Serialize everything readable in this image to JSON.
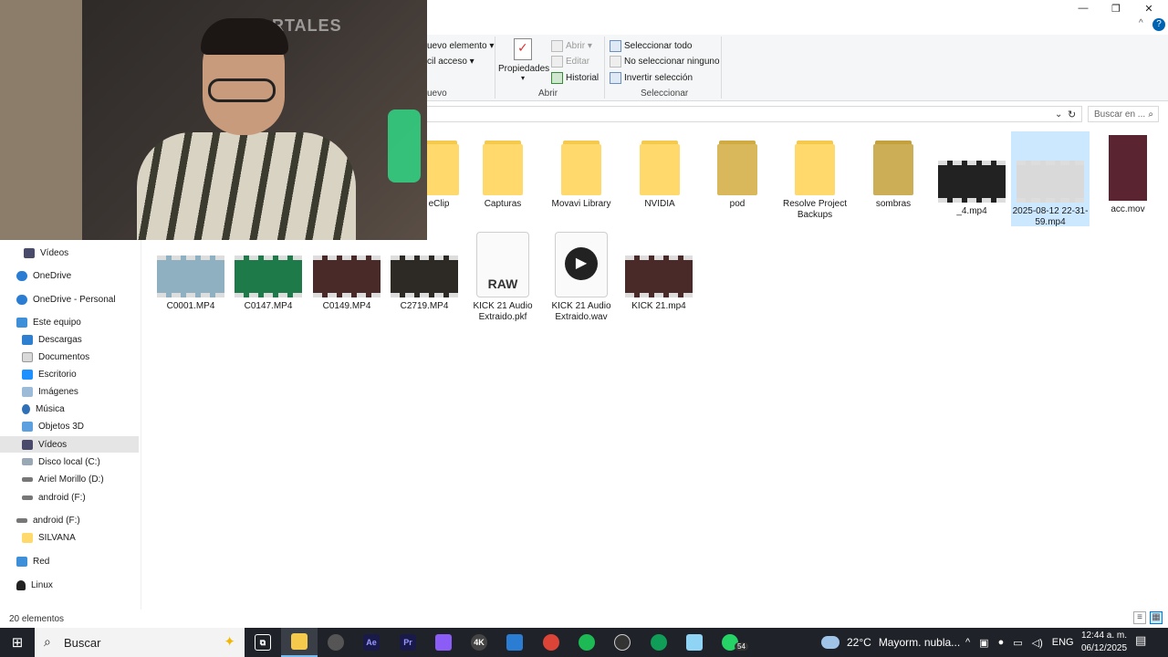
{
  "window": {
    "minimize": "—",
    "maximize": "❐",
    "close": "✕",
    "help": "?",
    "collapse": "^"
  },
  "ribbon": {
    "nuevo_elemento": "uevo elemento ▾",
    "facil_acceso": "cil acceso ▾",
    "nuevo_group": "uevo",
    "propiedades": "Propiedades",
    "abrir": "Abrir ▾",
    "editar": "Editar",
    "historial": "Historial",
    "abrir_group": "Abrir",
    "seleccionar_todo": "Seleccionar todo",
    "no_seleccionar": "No seleccionar ninguno",
    "invertir": "Invertir selección",
    "seleccionar_group": "Seleccionar"
  },
  "address": {
    "search_placeholder": "Buscar en ...",
    "search_icon": "search-icon"
  },
  "nav": {
    "items": [
      {
        "label": "Vídeos"
      },
      {
        "label": "OneDrive"
      },
      {
        "label": "OneDrive - Personal"
      },
      {
        "label": "Este equipo"
      },
      {
        "label": "Descargas"
      },
      {
        "label": "Documentos"
      },
      {
        "label": "Escritorio"
      },
      {
        "label": "Imágenes"
      },
      {
        "label": "Música"
      },
      {
        "label": "Objetos 3D"
      },
      {
        "label": "Vídeos"
      },
      {
        "label": "Disco local (C:)"
      },
      {
        "label": "Ariel Morillo (D:)"
      },
      {
        "label": "android (F:)"
      },
      {
        "label": "android (F:)"
      },
      {
        "label": "SILVANA"
      },
      {
        "label": "Red"
      },
      {
        "label": "Linux"
      }
    ]
  },
  "files": {
    "row1": [
      {
        "name": "eClip",
        "type": "folder"
      },
      {
        "name": "Capturas",
        "type": "folder"
      },
      {
        "name": "Movavi Library",
        "type": "folder"
      },
      {
        "name": "NVIDIA",
        "type": "folder"
      },
      {
        "name": "pod",
        "type": "folder"
      },
      {
        "name": "Resolve Project Backups",
        "type": "folder"
      },
      {
        "name": "sombras",
        "type": "folder"
      },
      {
        "name": "_4.mp4",
        "type": "video"
      },
      {
        "name": "2025-08-12 22-31-59.mp4",
        "type": "video"
      },
      {
        "name": "acc.mov",
        "type": "video"
      }
    ],
    "row2": [
      {
        "name": "C0001.MP4",
        "type": "video"
      },
      {
        "name": "C0147.MP4",
        "type": "video"
      },
      {
        "name": "C0149.MP4",
        "type": "video"
      },
      {
        "name": "C2719.MP4",
        "type": "video"
      },
      {
        "name": "KICK 21 Audio Extraido.pkf",
        "type": "raw",
        "badge": "RAW"
      },
      {
        "name": "KICK 21 Audio Extraido.wav",
        "type": "audio"
      },
      {
        "name": "KICK 21.mp4",
        "type": "video"
      }
    ]
  },
  "status": {
    "count": "20 elementos"
  },
  "taskbar": {
    "search_label": "Buscar",
    "weather_temp": "22°C",
    "weather_desc": "Mayorm. nubla...",
    "lang": "ENG",
    "time": "12:44 a. m.",
    "date": "06/12/2025",
    "badge": "54",
    "apps": [
      "task-view",
      "file-explorer",
      "resolve",
      "after-effects",
      "premiere",
      "app-purple",
      "4k-downloader",
      "remote-desktop",
      "chrome",
      "spotify",
      "obs",
      "chrome-2",
      "notepad",
      "whatsapp"
    ]
  },
  "webcam": {
    "sign": "PORTALES"
  }
}
